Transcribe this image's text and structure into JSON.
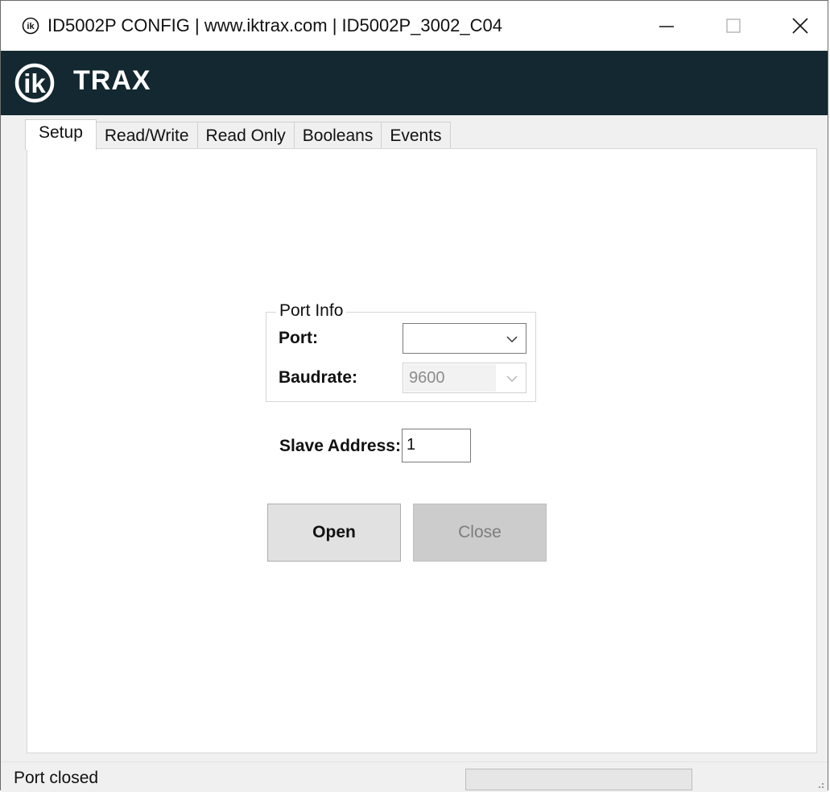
{
  "window": {
    "title": "ID5002P CONFIG | www.iktrax.com | ID5002P_3002_C04",
    "controls": {
      "minimize_icon": "minimize-icon",
      "maximize_icon": "maximize-icon",
      "close_icon": "close-icon"
    }
  },
  "brand": {
    "logo_icon": "iktrax-logo-icon",
    "name": "TRAX",
    "background": "#132830"
  },
  "tabs": [
    {
      "label": "Setup",
      "active": true
    },
    {
      "label": "Read/Write",
      "active": false
    },
    {
      "label": "Read Only",
      "active": false
    },
    {
      "label": "Booleans",
      "active": false
    },
    {
      "label": "Events",
      "active": false
    }
  ],
  "setup": {
    "port_info": {
      "legend": "Port Info",
      "port_label": "Port:",
      "port_value": "",
      "baudrate_label": "Baudrate:",
      "baudrate_value": "9600",
      "baudrate_enabled": false
    },
    "slave_address_label": "Slave Address:",
    "slave_address_value": "1",
    "open_label": "Open",
    "close_label": "Close",
    "close_enabled": false
  },
  "statusbar": {
    "status": "Port closed",
    "progress": 0
  }
}
